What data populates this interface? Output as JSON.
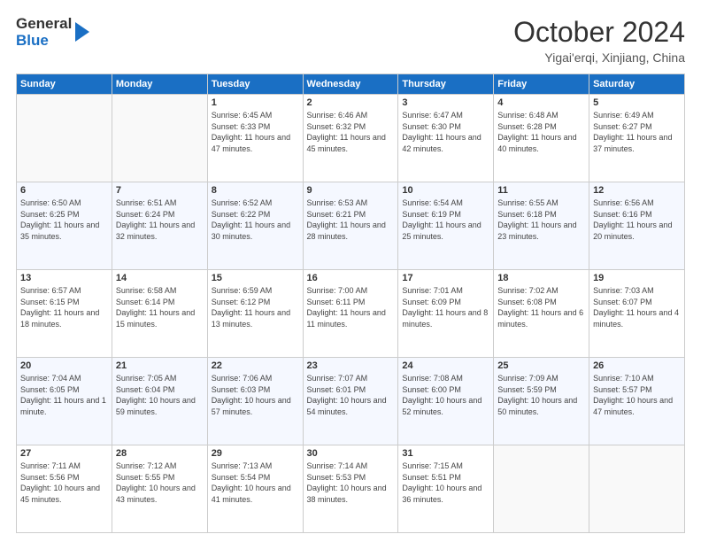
{
  "logo": {
    "line1": "General",
    "line2": "Blue"
  },
  "title": "October 2024",
  "location": "Yigai'erqi, Xinjiang, China",
  "days_of_week": [
    "Sunday",
    "Monday",
    "Tuesday",
    "Wednesday",
    "Thursday",
    "Friday",
    "Saturday"
  ],
  "weeks": [
    [
      {
        "day": "",
        "info": ""
      },
      {
        "day": "",
        "info": ""
      },
      {
        "day": "1",
        "info": "Sunrise: 6:45 AM\nSunset: 6:33 PM\nDaylight: 11 hours and 47 minutes."
      },
      {
        "day": "2",
        "info": "Sunrise: 6:46 AM\nSunset: 6:32 PM\nDaylight: 11 hours and 45 minutes."
      },
      {
        "day": "3",
        "info": "Sunrise: 6:47 AM\nSunset: 6:30 PM\nDaylight: 11 hours and 42 minutes."
      },
      {
        "day": "4",
        "info": "Sunrise: 6:48 AM\nSunset: 6:28 PM\nDaylight: 11 hours and 40 minutes."
      },
      {
        "day": "5",
        "info": "Sunrise: 6:49 AM\nSunset: 6:27 PM\nDaylight: 11 hours and 37 minutes."
      }
    ],
    [
      {
        "day": "6",
        "info": "Sunrise: 6:50 AM\nSunset: 6:25 PM\nDaylight: 11 hours and 35 minutes."
      },
      {
        "day": "7",
        "info": "Sunrise: 6:51 AM\nSunset: 6:24 PM\nDaylight: 11 hours and 32 minutes."
      },
      {
        "day": "8",
        "info": "Sunrise: 6:52 AM\nSunset: 6:22 PM\nDaylight: 11 hours and 30 minutes."
      },
      {
        "day": "9",
        "info": "Sunrise: 6:53 AM\nSunset: 6:21 PM\nDaylight: 11 hours and 28 minutes."
      },
      {
        "day": "10",
        "info": "Sunrise: 6:54 AM\nSunset: 6:19 PM\nDaylight: 11 hours and 25 minutes."
      },
      {
        "day": "11",
        "info": "Sunrise: 6:55 AM\nSunset: 6:18 PM\nDaylight: 11 hours and 23 minutes."
      },
      {
        "day": "12",
        "info": "Sunrise: 6:56 AM\nSunset: 6:16 PM\nDaylight: 11 hours and 20 minutes."
      }
    ],
    [
      {
        "day": "13",
        "info": "Sunrise: 6:57 AM\nSunset: 6:15 PM\nDaylight: 11 hours and 18 minutes."
      },
      {
        "day": "14",
        "info": "Sunrise: 6:58 AM\nSunset: 6:14 PM\nDaylight: 11 hours and 15 minutes."
      },
      {
        "day": "15",
        "info": "Sunrise: 6:59 AM\nSunset: 6:12 PM\nDaylight: 11 hours and 13 minutes."
      },
      {
        "day": "16",
        "info": "Sunrise: 7:00 AM\nSunset: 6:11 PM\nDaylight: 11 hours and 11 minutes."
      },
      {
        "day": "17",
        "info": "Sunrise: 7:01 AM\nSunset: 6:09 PM\nDaylight: 11 hours and 8 minutes."
      },
      {
        "day": "18",
        "info": "Sunrise: 7:02 AM\nSunset: 6:08 PM\nDaylight: 11 hours and 6 minutes."
      },
      {
        "day": "19",
        "info": "Sunrise: 7:03 AM\nSunset: 6:07 PM\nDaylight: 11 hours and 4 minutes."
      }
    ],
    [
      {
        "day": "20",
        "info": "Sunrise: 7:04 AM\nSunset: 6:05 PM\nDaylight: 11 hours and 1 minute."
      },
      {
        "day": "21",
        "info": "Sunrise: 7:05 AM\nSunset: 6:04 PM\nDaylight: 10 hours and 59 minutes."
      },
      {
        "day": "22",
        "info": "Sunrise: 7:06 AM\nSunset: 6:03 PM\nDaylight: 10 hours and 57 minutes."
      },
      {
        "day": "23",
        "info": "Sunrise: 7:07 AM\nSunset: 6:01 PM\nDaylight: 10 hours and 54 minutes."
      },
      {
        "day": "24",
        "info": "Sunrise: 7:08 AM\nSunset: 6:00 PM\nDaylight: 10 hours and 52 minutes."
      },
      {
        "day": "25",
        "info": "Sunrise: 7:09 AM\nSunset: 5:59 PM\nDaylight: 10 hours and 50 minutes."
      },
      {
        "day": "26",
        "info": "Sunrise: 7:10 AM\nSunset: 5:57 PM\nDaylight: 10 hours and 47 minutes."
      }
    ],
    [
      {
        "day": "27",
        "info": "Sunrise: 7:11 AM\nSunset: 5:56 PM\nDaylight: 10 hours and 45 minutes."
      },
      {
        "day": "28",
        "info": "Sunrise: 7:12 AM\nSunset: 5:55 PM\nDaylight: 10 hours and 43 minutes."
      },
      {
        "day": "29",
        "info": "Sunrise: 7:13 AM\nSunset: 5:54 PM\nDaylight: 10 hours and 41 minutes."
      },
      {
        "day": "30",
        "info": "Sunrise: 7:14 AM\nSunset: 5:53 PM\nDaylight: 10 hours and 38 minutes."
      },
      {
        "day": "31",
        "info": "Sunrise: 7:15 AM\nSunset: 5:51 PM\nDaylight: 10 hours and 36 minutes."
      },
      {
        "day": "",
        "info": ""
      },
      {
        "day": "",
        "info": ""
      }
    ]
  ]
}
